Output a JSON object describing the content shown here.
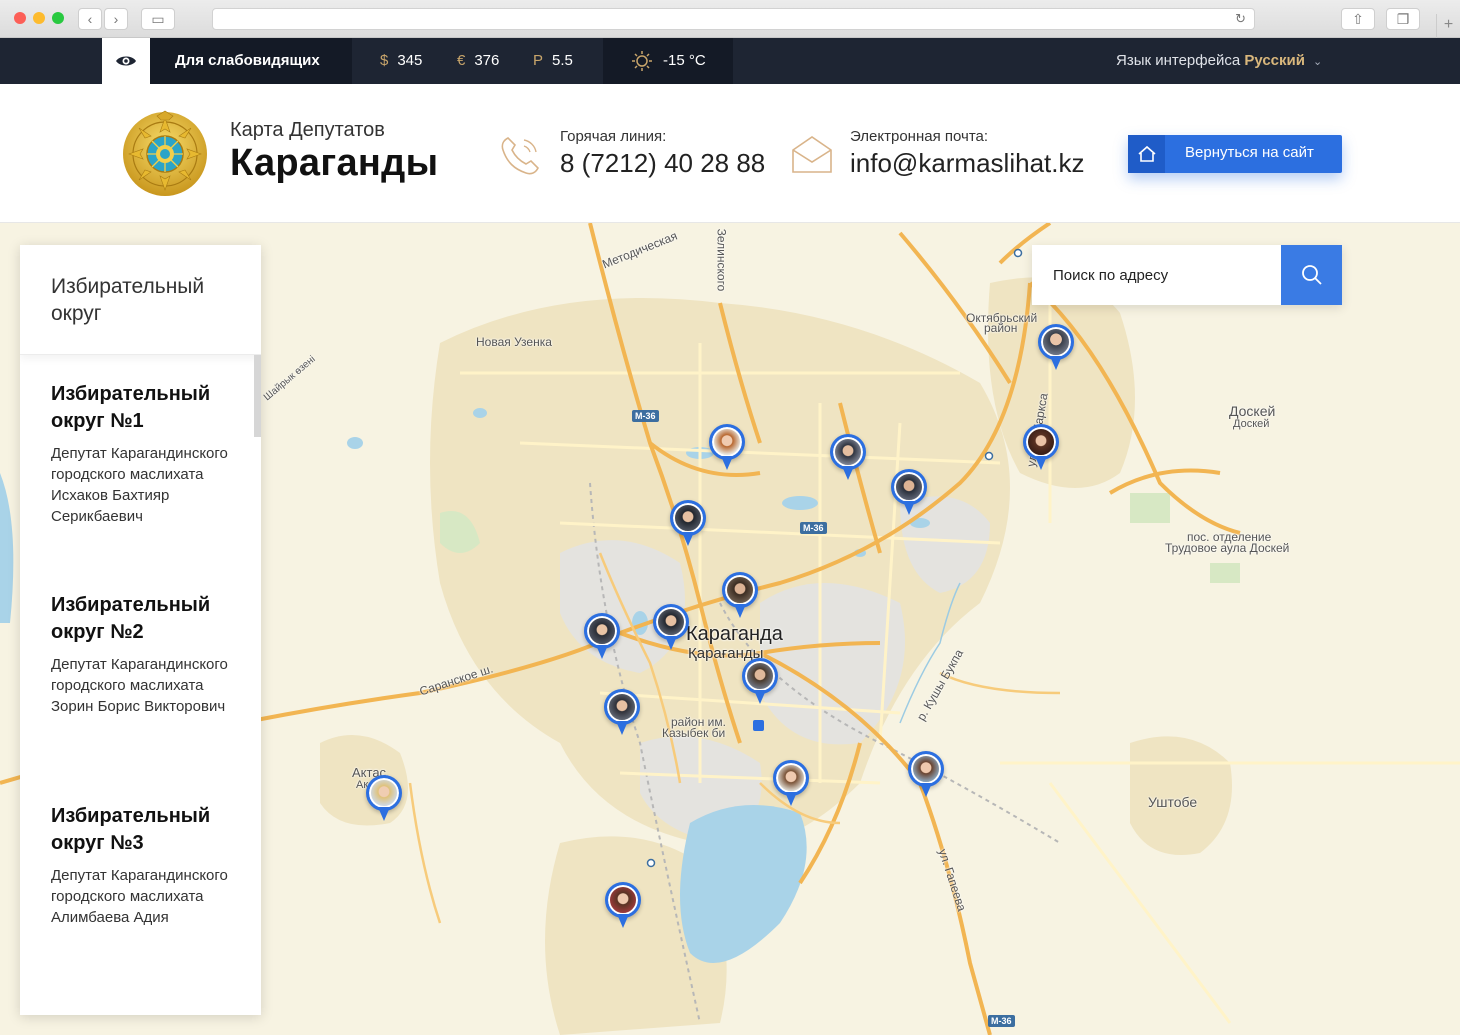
{
  "topbar": {
    "accessibility_label": "Для слабовидящих",
    "currencies": [
      {
        "symbol": "$",
        "value": "345"
      },
      {
        "symbol": "€",
        "value": "376"
      },
      {
        "symbol": "Р",
        "value": "5.5"
      }
    ],
    "weather": "-15 °C",
    "language_label": "Язык интерфейса",
    "language_value": "Русский"
  },
  "header": {
    "title_small": "Карта Депутатов",
    "title_big": "Караганды",
    "hotline_label": "Горячая линия:",
    "hotline_value": "8 (7212) 40 28 88",
    "email_label": "Электронная почта:",
    "email_value": "info@karmaslihat.kz",
    "back_button": "Вернуться на сайт"
  },
  "search": {
    "placeholder": "Поиск по адресу"
  },
  "sidebar": {
    "title": "Избирательный округ",
    "districts": [
      {
        "name": "Избирательный округ №1",
        "desc": "Депутат Карагандинского городского маслихата Исхаков Бахтияр Серикбаевич"
      },
      {
        "name": "Избирательный округ №2",
        "desc": "Депутат Карагандинского городского маслихата Зорин Борис Викторович"
      },
      {
        "name": "Избирательный округ №3",
        "desc": "Депутат Карагандинского городского маслихата Алимбаева Адия"
      }
    ]
  },
  "map": {
    "labels": {
      "city": "Караганда",
      "city_kz": "Қарағанды",
      "novaya_uzenka": "Новая Узенка",
      "oktyabrsky": "Октябрьский",
      "rayon": "район",
      "doskey": "Доскей",
      "doskey_kz": "Доскей",
      "pos_otdelenie": "пос. отделение",
      "trudovoe": "Трудовое аула Доскей",
      "ushtobe": "Уштобе",
      "aktas": "Актас",
      "aktas_kz": "Ак",
      "kazybek": "район им.",
      "kazybek2": "Казыбек би",
      "saranskoe": "Саранское ш.",
      "gapeeva": "ул. Гапеева",
      "metodicheskaya": "Методическая",
      "zelinskogo": "Зелинского",
      "karla_marksa": "ул. К. Маркса",
      "kushi_bukpa": "р. Кушы Букпа",
      "shairyk": "Шайрык өзені",
      "m36": "М-36"
    },
    "accent_color": "#2c6fe0"
  }
}
